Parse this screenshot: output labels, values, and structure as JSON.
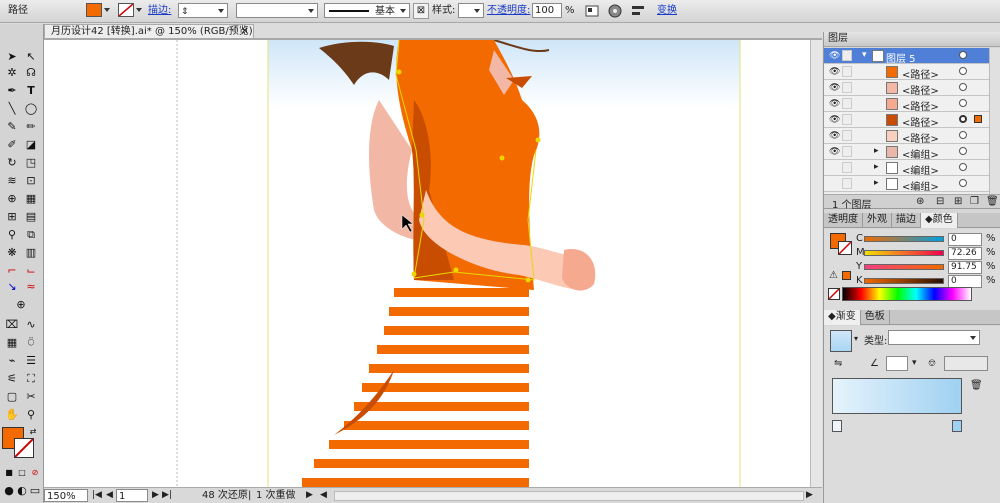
{
  "control_bar": {
    "object_type": "路径",
    "stroke_label": "描边:",
    "stroke_profile": "基本",
    "style_label": "样式:",
    "opacity_label": "不透明度:",
    "opacity_value": "100",
    "opacity_unit": "%",
    "transform_label": "变换",
    "fill_color": "#f26a00"
  },
  "document_tab": {
    "title": "月历设计42 [转换].ai* @ 150% (RGB/预览)",
    "close": "✕"
  },
  "layers_panel": {
    "title": "图层",
    "rows": [
      {
        "name": "图层 5",
        "selected": true
      },
      {
        "name": "<路径>",
        "selected": false
      },
      {
        "name": "<路径>",
        "selected": false
      },
      {
        "name": "<路径>",
        "selected": false
      },
      {
        "name": "<路径>",
        "selected": false
      },
      {
        "name": "<路径>",
        "selected": false
      },
      {
        "name": "<编组>",
        "selected": false
      },
      {
        "name": "<编组>",
        "selected": false
      },
      {
        "name": "<编组>",
        "selected": false
      }
    ],
    "footer": "1 个图层"
  },
  "color_panel": {
    "tabs": [
      "透明度",
      "外观",
      "描边",
      "颜色"
    ],
    "active_tab": "颜色",
    "channels": [
      {
        "label": "C",
        "value": "0",
        "unit": "%"
      },
      {
        "label": "M",
        "value": "72.26",
        "unit": "%"
      },
      {
        "label": "Y",
        "value": "91.75",
        "unit": "%"
      },
      {
        "label": "K",
        "value": "0",
        "unit": "%"
      }
    ],
    "swatch": "#f26a00"
  },
  "gradient_panel": {
    "tabs": [
      "渐变",
      "色板"
    ],
    "active_tab": "渐变",
    "type_label": "类型:"
  },
  "status_bar": {
    "zoom": "150%",
    "page": "1",
    "undo_info": "48 次还原",
    "redo_info": "1 次重做"
  },
  "tools": {
    "fill_color": "#f26a00"
  }
}
